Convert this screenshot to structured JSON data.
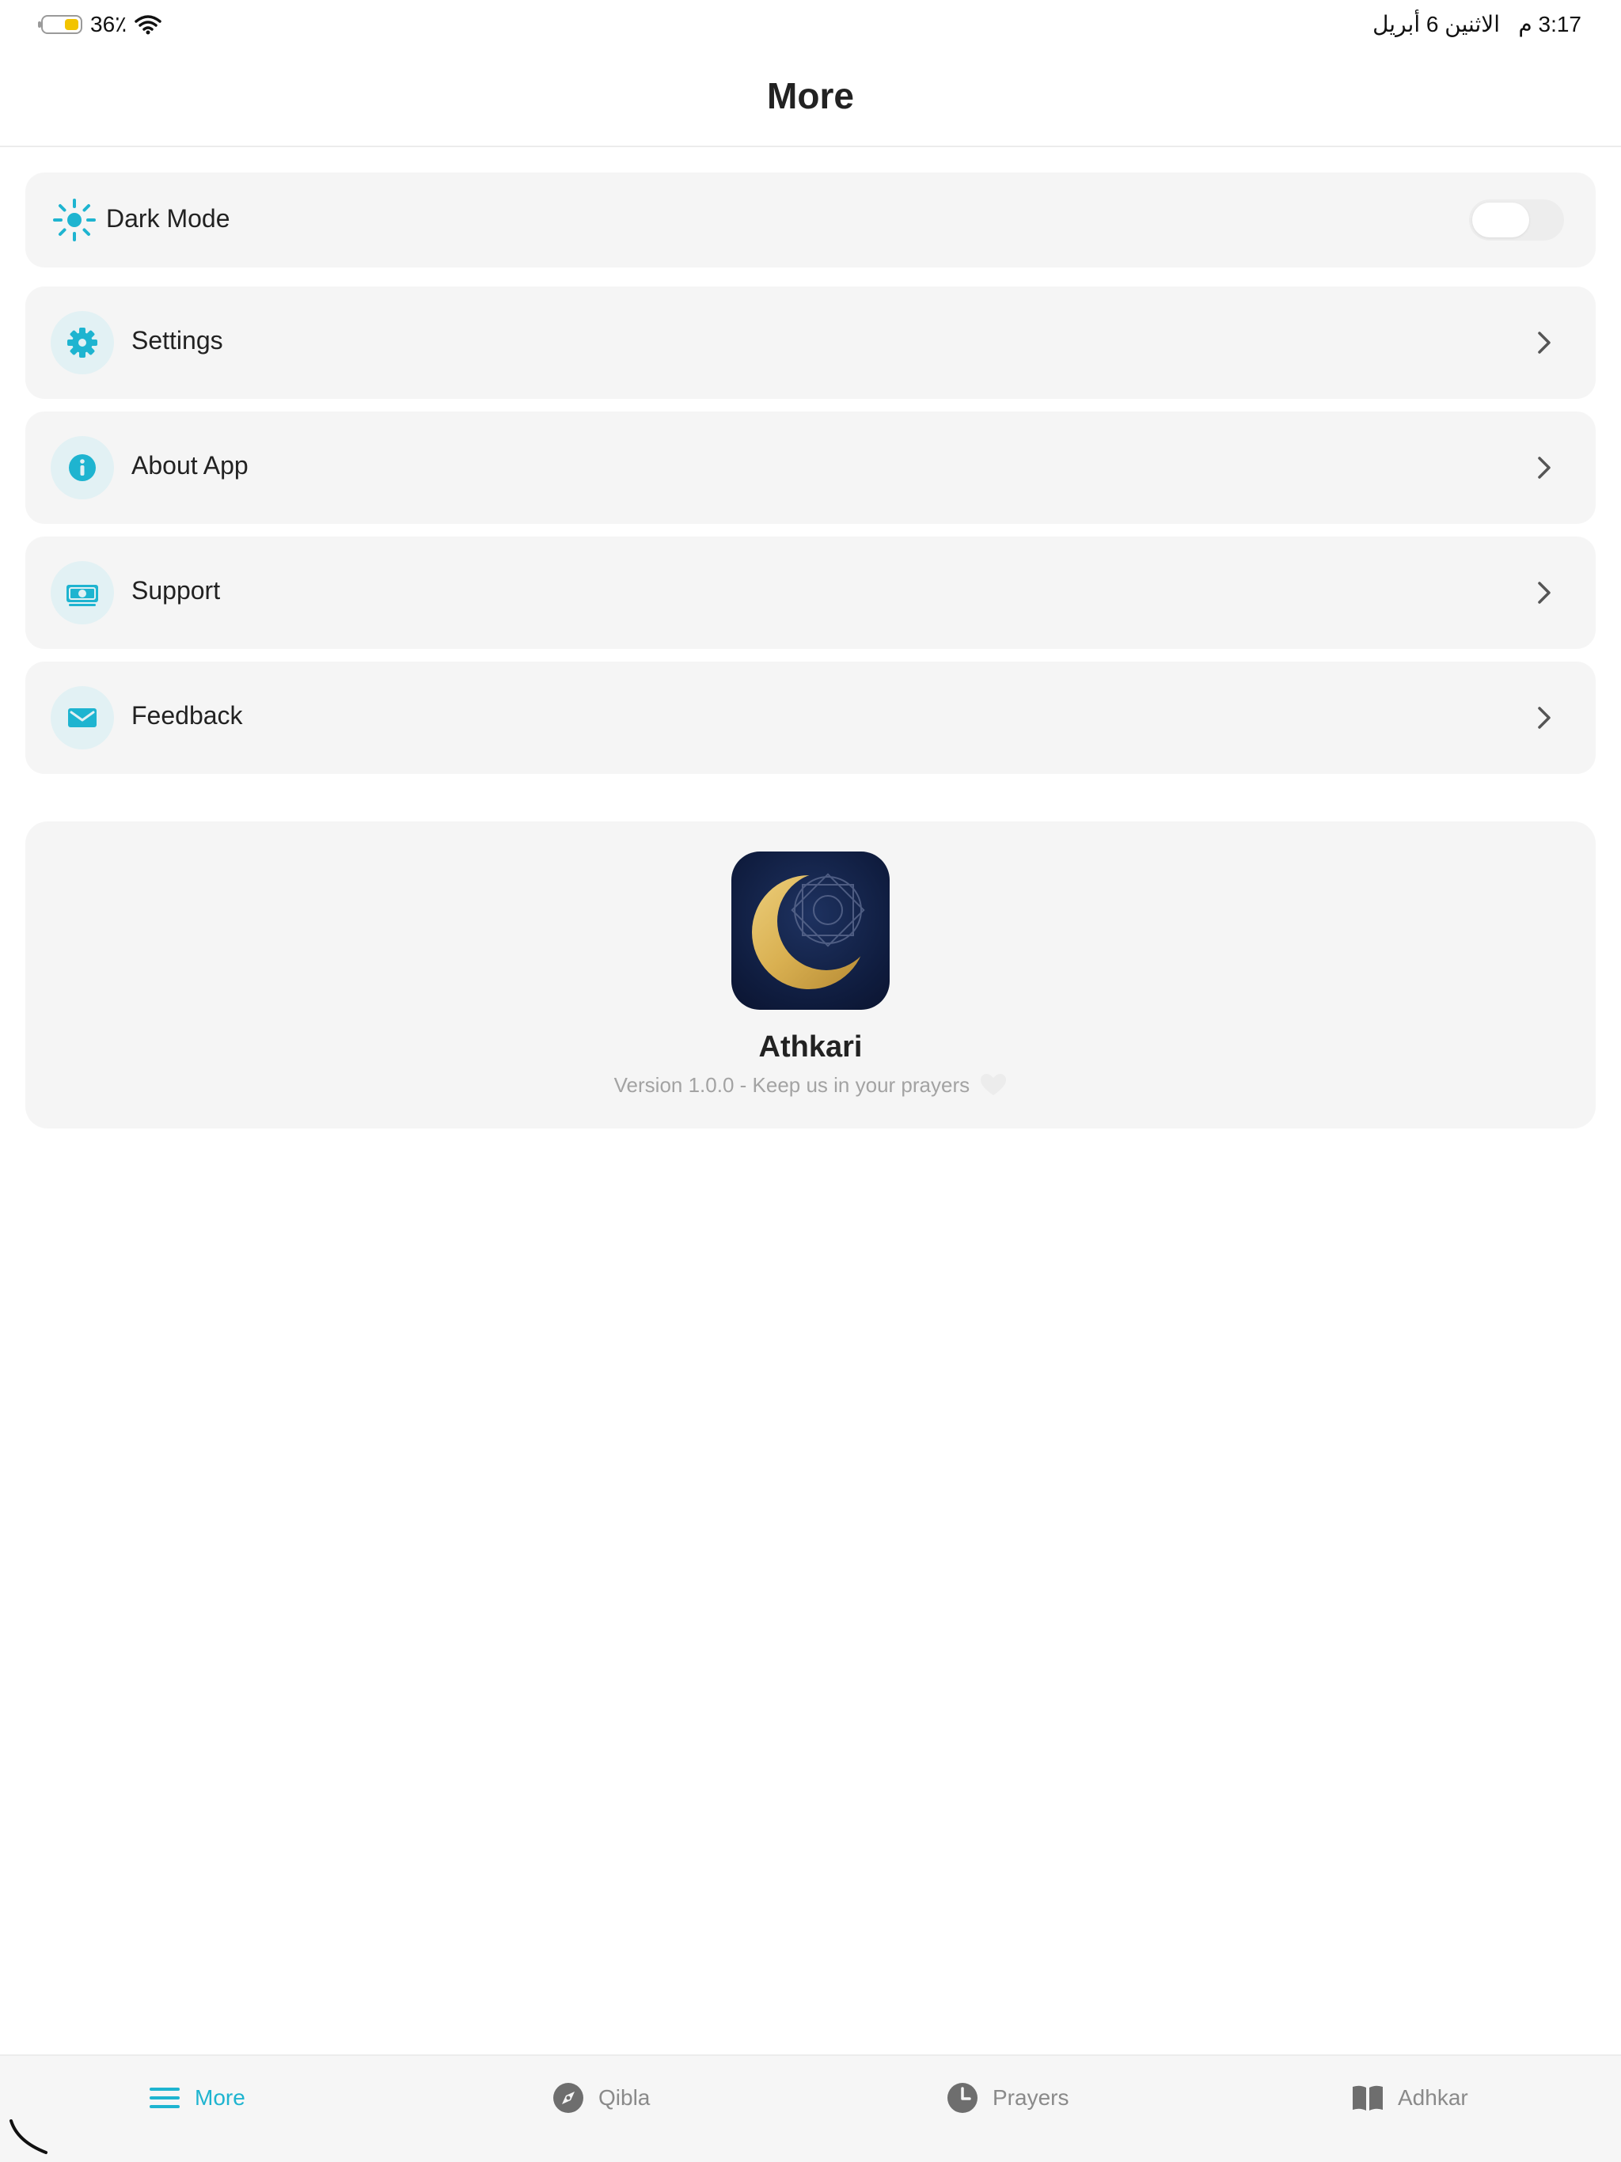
{
  "status_bar": {
    "battery_percent": "36٪",
    "battery_level": 0.36,
    "time": "3:17",
    "ampm": "م",
    "date": "الاثنين 6 أبريل"
  },
  "header": {
    "title": "More"
  },
  "dark_mode": {
    "label": "Dark Mode",
    "enabled": false
  },
  "menu": [
    {
      "label": "Settings",
      "icon": "gear-icon"
    },
    {
      "label": "About App",
      "icon": "info-icon"
    },
    {
      "label": "Support",
      "icon": "money-icon"
    },
    {
      "label": "Feedback",
      "icon": "mail-icon"
    }
  ],
  "about": {
    "app_name": "Athkari",
    "version": "Version 1.0.0 - Keep us in your prayers"
  },
  "tabs": [
    {
      "label": "More",
      "icon": "menu-icon",
      "active": true
    },
    {
      "label": "Qibla",
      "icon": "compass-icon",
      "active": false
    },
    {
      "label": "Prayers",
      "icon": "clock-icon",
      "active": false
    },
    {
      "label": "Adhkar",
      "icon": "book-icon",
      "active": false
    }
  ],
  "colors": {
    "accent": "#1eb4d0",
    "icon_bg": "#e2f1f4",
    "card_bg": "#f5f5f5",
    "app_icon_bg": "#0f1c3e",
    "crescent_gold": "#d9b051"
  }
}
